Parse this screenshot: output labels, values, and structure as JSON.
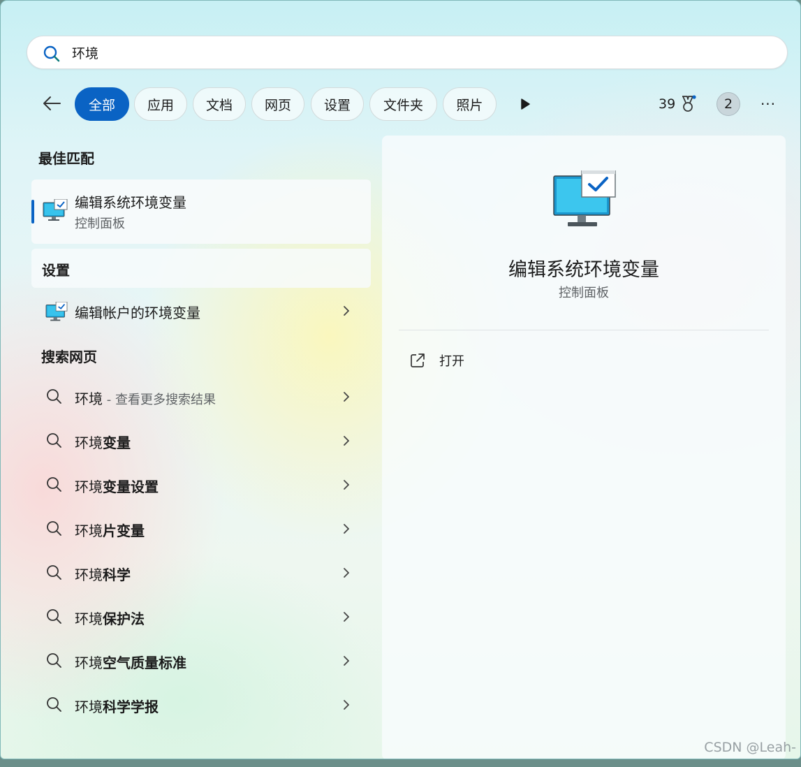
{
  "search": {
    "query": "环境"
  },
  "filters": [
    {
      "label": "全部",
      "active": true
    },
    {
      "label": "应用"
    },
    {
      "label": "文档"
    },
    {
      "label": "网页"
    },
    {
      "label": "设置"
    },
    {
      "label": "文件夹"
    },
    {
      "label": "照片"
    }
  ],
  "header": {
    "points": "39",
    "avatar_initial": "2",
    "more": "···"
  },
  "left": {
    "best_match_title": "最佳匹配",
    "best_match": {
      "title": "编辑系统环境变量",
      "subtitle": "控制面板"
    },
    "settings_title": "设置",
    "settings_item": "编辑帐户的环境变量",
    "web_title": "搜索网页",
    "web_results": [
      {
        "prefix": "环境",
        "bold": "",
        "suffix": " - 查看更多搜索结果"
      },
      {
        "prefix": "环境",
        "bold": "变量"
      },
      {
        "prefix": "环境",
        "bold": "变量设置"
      },
      {
        "prefix": "环境",
        "bold": "片变量"
      },
      {
        "prefix": "环境",
        "bold": "科学"
      },
      {
        "prefix": "环境",
        "bold": "保护法"
      },
      {
        "prefix": "环境",
        "bold": "空气质量标准"
      },
      {
        "prefix": "环境",
        "bold": "科学学报"
      }
    ]
  },
  "detail": {
    "title": "编辑系统环境变量",
    "subtitle": "控制面板",
    "open_label": "打开"
  },
  "watermark": "CSDN @Leah-",
  "colors": {
    "accent": "#0a63c4"
  }
}
